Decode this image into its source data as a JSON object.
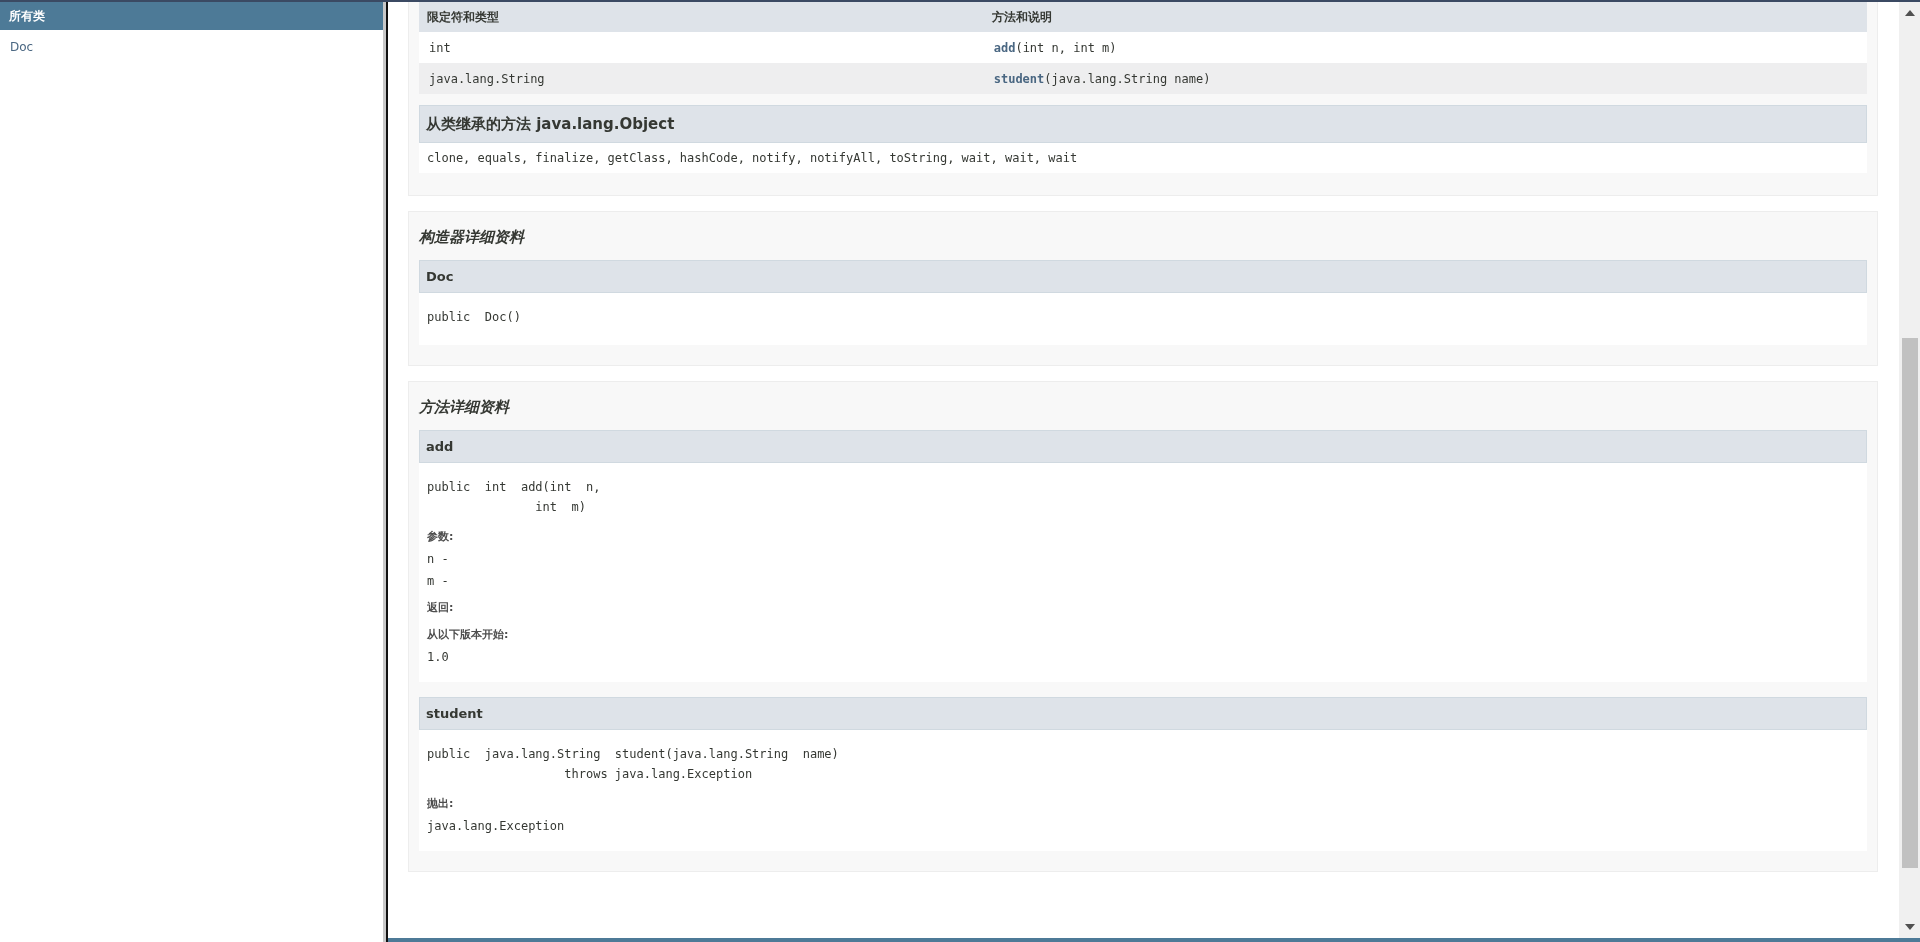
{
  "sidebar": {
    "title": "所有类",
    "items": [
      {
        "label": "Doc"
      }
    ]
  },
  "summary": {
    "columns": [
      "限定符和类型",
      "方法和说明"
    ],
    "rows": [
      {
        "type": "int",
        "method": "add",
        "params": "(int  n, int  m)"
      },
      {
        "type": "java.lang.String",
        "method": "student",
        "params": "(java.lang.String  name)"
      }
    ],
    "inherited": {
      "title": "从类继承的方法 java.lang.Object",
      "methods": "clone, equals, finalize, getClass, hashCode, notify, notifyAll, toString, wait, wait, wait"
    }
  },
  "constructor_detail": {
    "title": "构造器详细资料",
    "items": [
      {
        "name": "Doc",
        "signature": "public  Doc()"
      }
    ]
  },
  "method_detail": {
    "title": "方法详细资料",
    "items": [
      {
        "name": "add",
        "signature": "public  int  add(int  n,\n               int  m)",
        "sections": [
          {
            "label": "参数:",
            "values": [
              "n -",
              "m -"
            ]
          },
          {
            "label": "返回:"
          },
          {
            "label": "从以下版本开始:",
            "values": [
              "1.0"
            ]
          }
        ]
      },
      {
        "name": "student",
        "signature": "public  java.lang.String  student(java.lang.String  name)\n                   throws java.lang.Exception",
        "sections": [
          {
            "label": "抛出:",
            "values": [
              "java.lang.Exception"
            ]
          }
        ]
      }
    ]
  }
}
